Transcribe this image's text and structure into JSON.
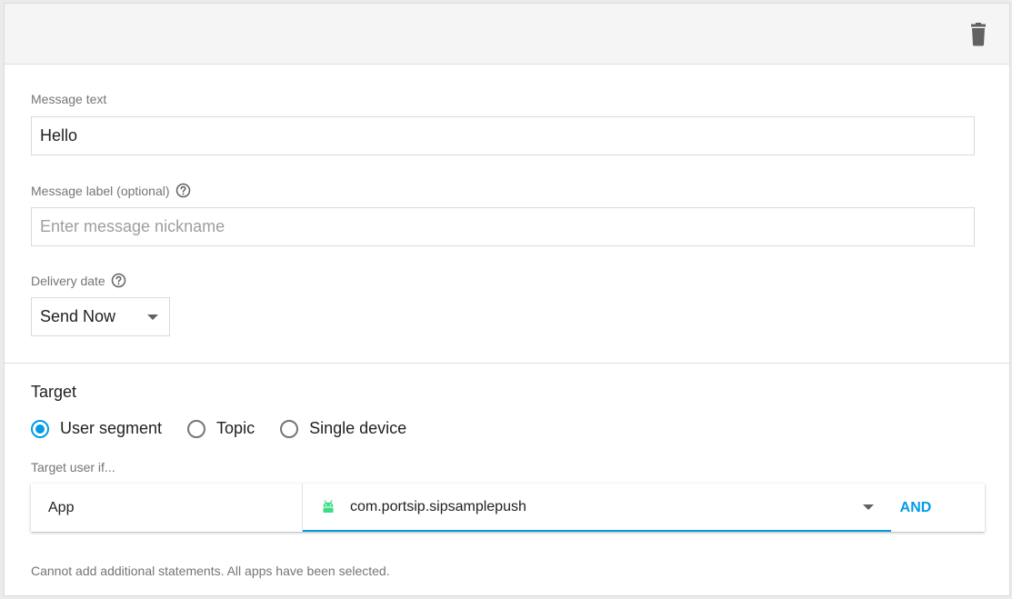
{
  "colors": {
    "accent": "#039be5",
    "android_green": "#3ddc84"
  },
  "header": {
    "delete_icon": "trash-icon"
  },
  "message_text": {
    "label": "Message text",
    "value": "Hello"
  },
  "message_label": {
    "label": "Message label (optional)",
    "placeholder": "Enter message nickname",
    "help_icon": "help-circle-icon"
  },
  "delivery_date": {
    "label": "Delivery date",
    "selected": "Send Now",
    "help_icon": "help-circle-icon"
  },
  "target": {
    "title": "Target",
    "options": [
      {
        "label": "User segment",
        "checked": true
      },
      {
        "label": "Topic",
        "checked": false
      },
      {
        "label": "Single device",
        "checked": false
      }
    ],
    "sub_label": "Target user if...",
    "condition": {
      "key": "App",
      "value": "com.portsip.sipsamplepush",
      "value_icon": "android-icon",
      "and_label": "AND"
    },
    "note": "Cannot add additional statements. All apps have been selected."
  }
}
